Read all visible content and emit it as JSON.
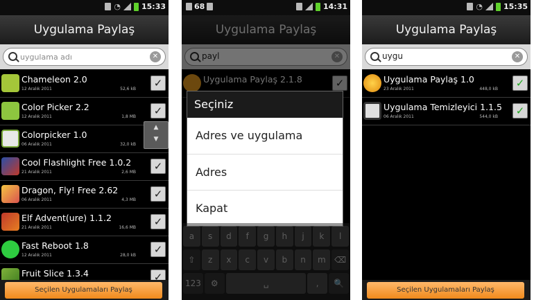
{
  "colors": {
    "accent_orange": "#f08a1c",
    "check_green": "#1fa81f",
    "title_bg": "#2a2a2a"
  },
  "phone1": {
    "status": {
      "time": "15:33"
    },
    "title": "Uygulama Paylaş",
    "search": {
      "placeholder": "uygulama adı"
    },
    "apps": [
      {
        "name": "Chameleon 2.0",
        "date": "12 Aralık 2011",
        "size": "52,6 kB",
        "icon": "android-icon"
      },
      {
        "name": "Color Picker 2.2",
        "date": "12 Aralık 2011",
        "size": "1,8 MB",
        "icon": "android-icon"
      },
      {
        "name": "Colorpicker 1.0",
        "date": "06 Aralık 2011",
        "size": "32,0 kB",
        "icon": "colorpicker-icon"
      },
      {
        "name": "Cool Flashlight Free 1.0.2",
        "date": "21 Aralık 2011",
        "size": "2,6 MB",
        "icon": "flashlight-icon"
      },
      {
        "name": "Dragon, Fly! Free 2.62",
        "date": "06 Aralık 2011",
        "size": "4,3 MB",
        "icon": "dragon-icon"
      },
      {
        "name": "Elf Advent(ure) 1.1.2",
        "date": "21 Aralık 2011",
        "size": "16,6 MB",
        "icon": "elf-icon"
      },
      {
        "name": "Fast Reboot 1.8",
        "date": "12 Aralık 2011",
        "size": "28,0 kB",
        "icon": "reboot-icon"
      },
      {
        "name": "Fruit Slice 1.3.4",
        "date": "",
        "size": "",
        "icon": "fruit-icon"
      }
    ],
    "share_button": "Seçilen Uygulamaları Paylaş"
  },
  "phone2": {
    "status": {
      "time": "14:31",
      "battery": "68"
    },
    "title": "Uygulama Paylaş",
    "search": {
      "value": "payl"
    },
    "background_item": "Uygulama Paylaş 2.1.8",
    "dialog": {
      "title": "Seçiniz",
      "options": [
        "Adres ve uygulama",
        "Adres",
        "Kapat"
      ]
    },
    "keyboard": {
      "row1": [
        "a",
        "s",
        "d",
        "f",
        "g",
        "h",
        "j",
        "k",
        "l"
      ],
      "row2": [
        "⇧",
        "z",
        "x",
        "c",
        "v",
        "b",
        "n",
        "m",
        "⌫"
      ],
      "row3": [
        "123",
        "⚙",
        "␣",
        ",",
        "🔍"
      ]
    }
  },
  "phone3": {
    "status": {
      "time": "15:35"
    },
    "title": "Uygulama Paylaş",
    "search": {
      "value": "uygu"
    },
    "apps": [
      {
        "name": "Uygulama Paylaş 1.0",
        "date": "23 Aralık 2011",
        "size": "448,0 kB",
        "icon": "share-app-icon"
      },
      {
        "name": "Uygulama Temizleyici 1.1.5",
        "date": "06 Aralık 2011",
        "size": "544,0 kB",
        "icon": "cleaner-app-icon"
      }
    ],
    "share_button": "Seçilen Uygulamaları Paylaş"
  }
}
